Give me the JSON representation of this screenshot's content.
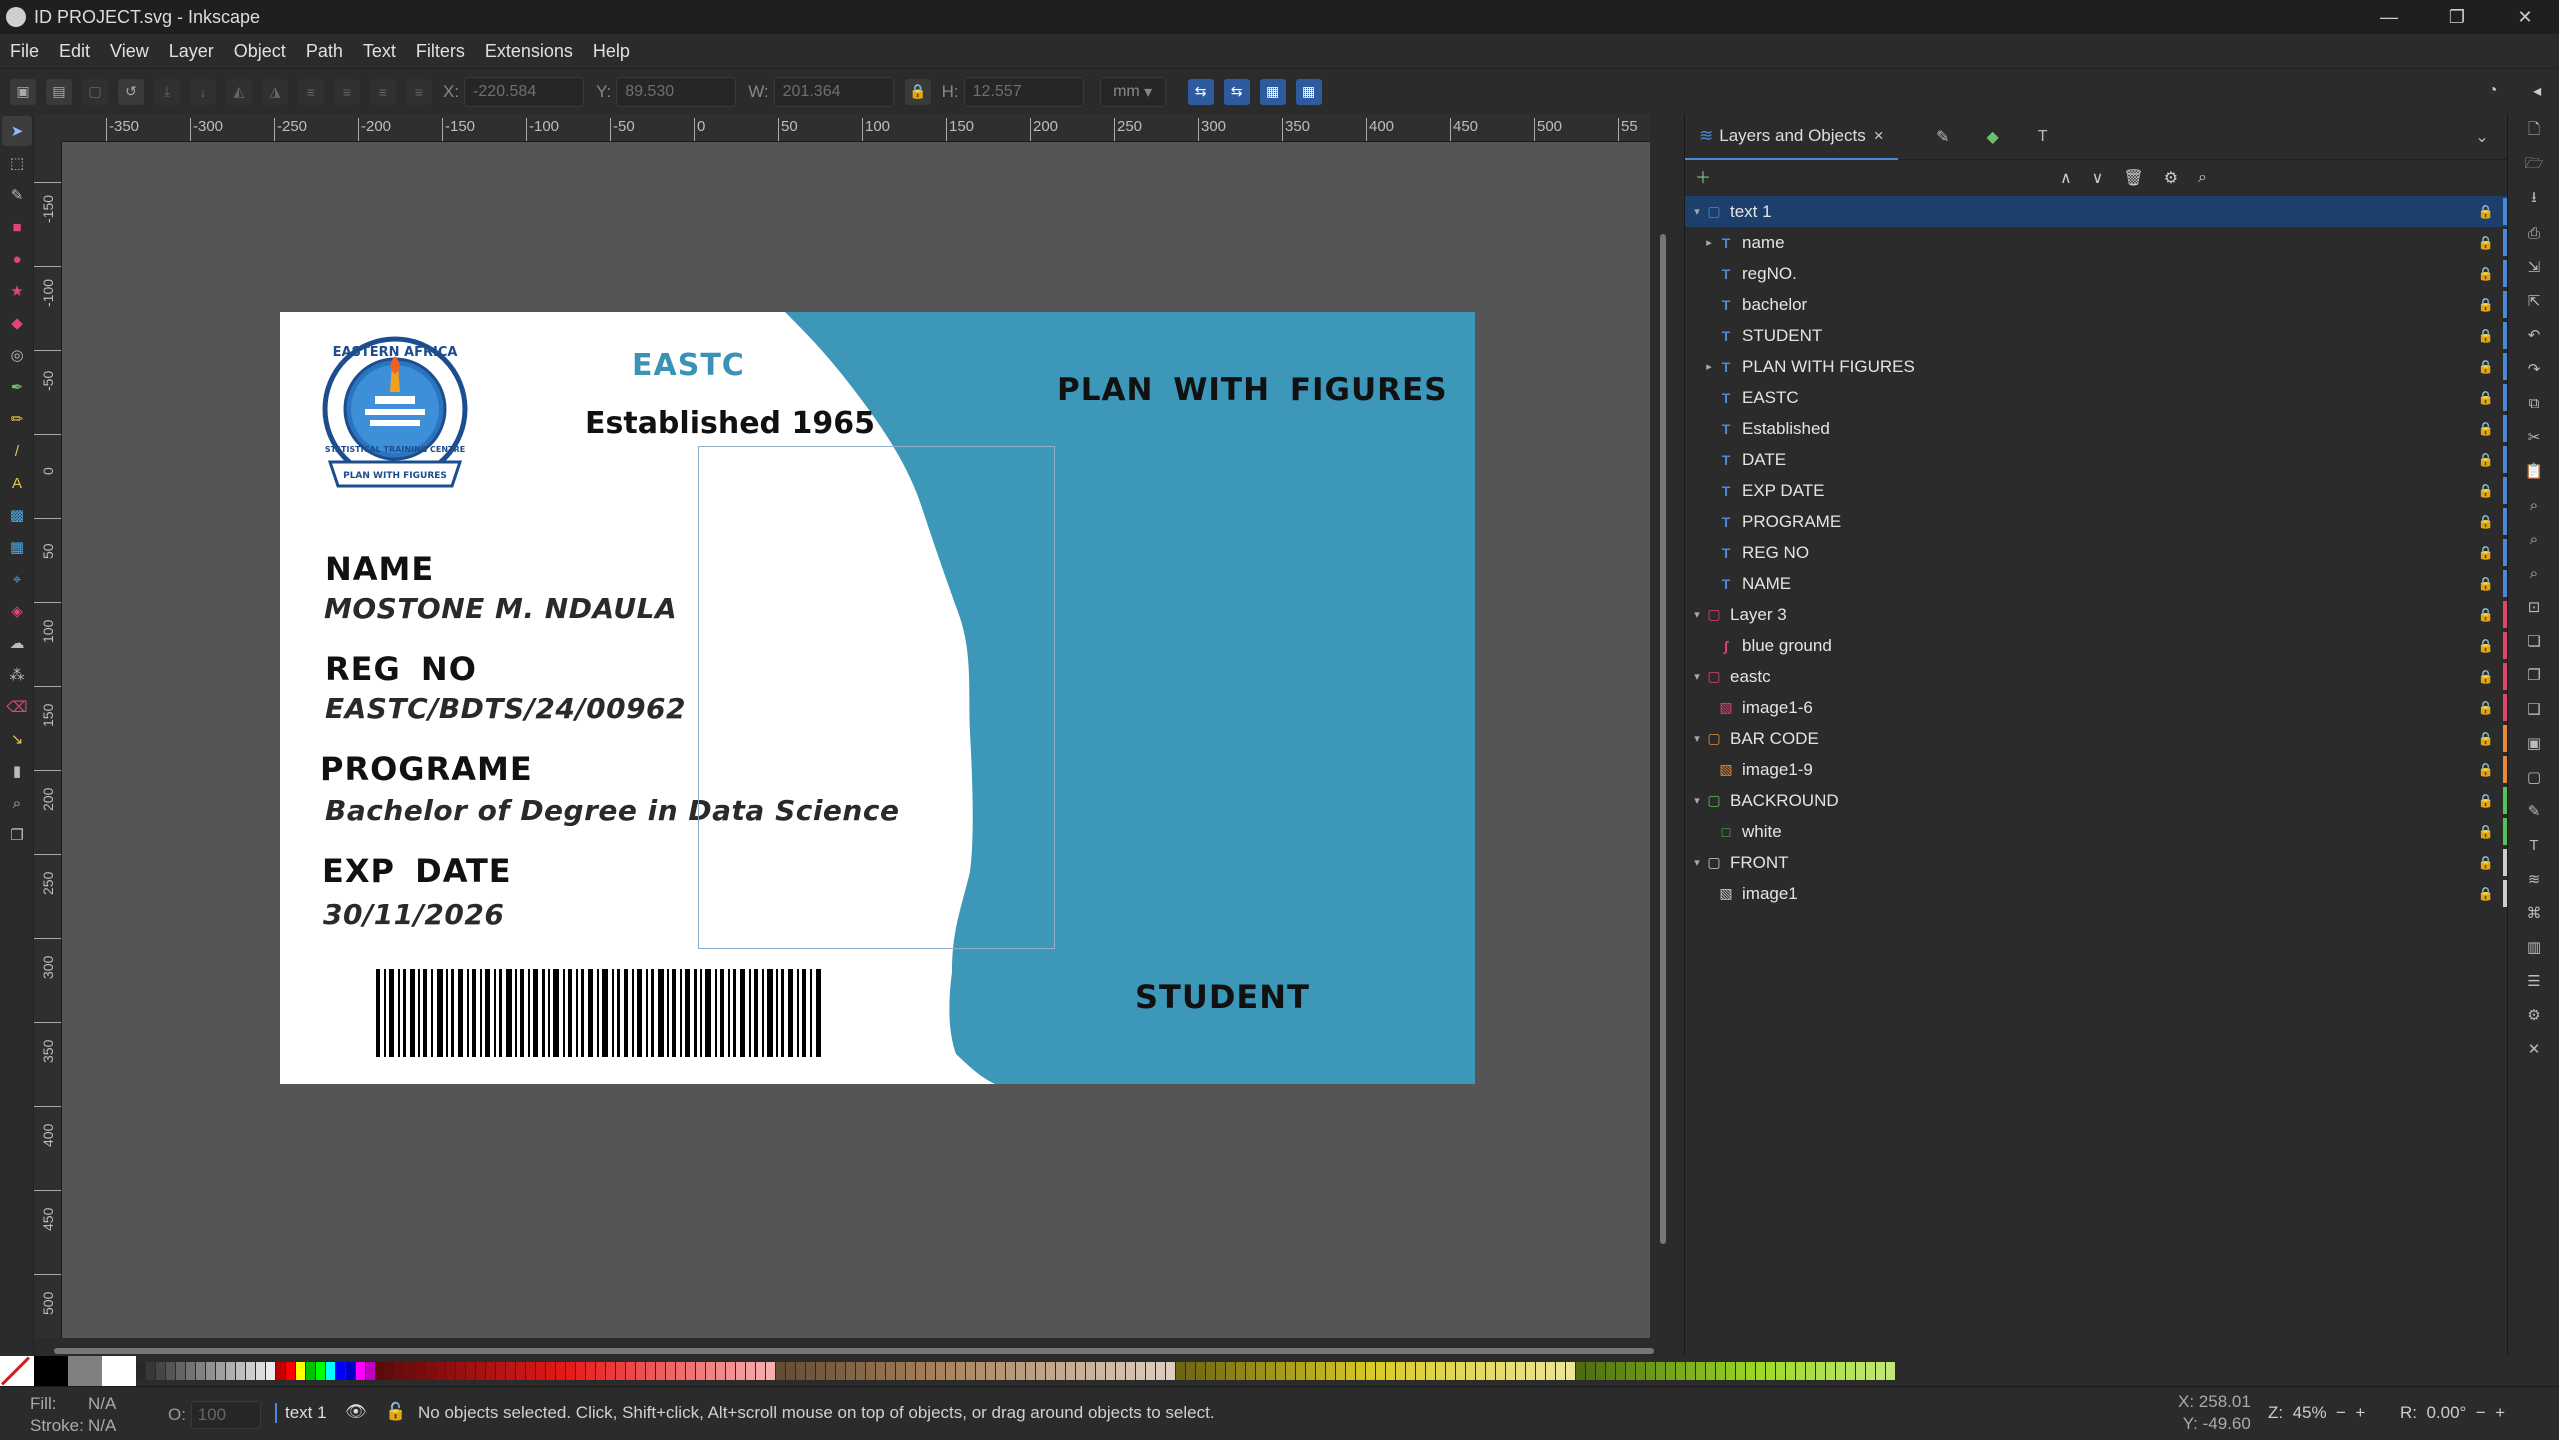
{
  "window": {
    "title": "ID PROJECT.svg - Inkscape",
    "controls": [
      "—",
      "❐",
      "✕"
    ]
  },
  "menu": [
    "File",
    "Edit",
    "View",
    "Layer",
    "Object",
    "Path",
    "Text",
    "Filters",
    "Extensions",
    "Help"
  ],
  "toolcontrols": {
    "x_label": "X:",
    "x_value": "-220.584",
    "y_label": "Y:",
    "y_value": "89.530",
    "w_label": "W:",
    "w_value": "201.364",
    "h_label": "H:",
    "h_value": "12.557",
    "unit": "mm"
  },
  "ruler": {
    "h_ticks": [
      "-350",
      "-300",
      "-250",
      "-200",
      "-150",
      "-100",
      "-50",
      "0",
      "50",
      "100",
      "150",
      "200",
      "250",
      "300",
      "350",
      "400",
      "450",
      "500",
      "55"
    ],
    "v_ticks": [
      "-150",
      "-100",
      "-50",
      "0",
      "50",
      "100",
      "150",
      "200",
      "250",
      "300",
      "350",
      "400",
      "450",
      "500"
    ]
  },
  "card": {
    "eastc": "EASTC",
    "established": "Established  1965",
    "motto": "PLAN  WITH  FIGURES",
    "name_label": "NAME",
    "name_value": "MOSTONE M. NDAULA",
    "reg_label": "REG  NO",
    "reg_value": "EASTC/BDTS/24/00962",
    "program_label": "PROGRAME",
    "program_value": "Bachelor of Degree in Data Science",
    "exp_label": "EXP DATE",
    "exp_value": "30/11/2026",
    "student": "STUDENT",
    "logo_text_top": "EASTERN  AFRICA",
    "logo_text_bottom": "STATISTICAL TRAINING CENTRE",
    "logo_ribbon": "PLAN WITH FIGURES",
    "accent": "#3d97b8"
  },
  "dock": {
    "tab_label": "Layers and Objects",
    "tab_close": "×",
    "items": [
      {
        "label": "text 1",
        "icon": "group-icon",
        "color": "#4a8ad8",
        "selected": true,
        "expander": "▾",
        "indent": 0
      },
      {
        "label": "name",
        "icon": "text-icon",
        "color": "#4a8ad8",
        "expander": "▸",
        "indent": 1
      },
      {
        "label": "regNO.",
        "icon": "text-icon",
        "color": "#4a8ad8",
        "indent": 1
      },
      {
        "label": "bachelor",
        "icon": "text-icon",
        "color": "#4a8ad8",
        "indent": 1
      },
      {
        "label": "STUDENT",
        "icon": "text-icon",
        "color": "#4a8ad8",
        "indent": 1
      },
      {
        "label": "PLAN WITH FIGURES",
        "icon": "text-icon",
        "color": "#4a8ad8",
        "expander": "▸",
        "indent": 1
      },
      {
        "label": "EASTC",
        "icon": "text-icon",
        "color": "#4a8ad8",
        "indent": 1
      },
      {
        "label": "Established",
        "icon": "text-icon",
        "color": "#4a8ad8",
        "indent": 1
      },
      {
        "label": "DATE",
        "icon": "text-icon",
        "color": "#4a8ad8",
        "indent": 1
      },
      {
        "label": "EXP DATE",
        "icon": "text-icon",
        "color": "#4a8ad8",
        "indent": 1
      },
      {
        "label": "PROGRAME",
        "icon": "text-icon",
        "color": "#4a8ad8",
        "indent": 1
      },
      {
        "label": "REG NO",
        "icon": "text-icon",
        "color": "#4a8ad8",
        "indent": 1
      },
      {
        "label": "NAME",
        "icon": "text-icon",
        "color": "#4a8ad8",
        "indent": 1
      },
      {
        "label": "Layer 3",
        "icon": "layer-icon",
        "color": "#e0456a",
        "expander": "▾",
        "indent": 0
      },
      {
        "label": "blue ground",
        "icon": "path-icon",
        "color": "#e0456a",
        "indent": 1
      },
      {
        "label": "eastc",
        "icon": "layer-icon",
        "color": "#e0456a",
        "expander": "▾",
        "indent": 0
      },
      {
        "label": "image1-6",
        "icon": "image-icon",
        "color": "#e0456a",
        "indent": 1
      },
      {
        "label": "BAR CODE",
        "icon": "layer-icon",
        "color": "#e88a3a",
        "expander": "▾",
        "indent": 0
      },
      {
        "label": "image1-9",
        "icon": "image-icon",
        "color": "#e88a3a",
        "indent": 1
      },
      {
        "label": "BACKROUND",
        "icon": "layer-icon",
        "color": "#57c357",
        "expander": "▾",
        "indent": 0
      },
      {
        "label": "white",
        "icon": "rect-icon",
        "color": "#57c357",
        "indent": 1
      },
      {
        "label": "FRONT",
        "icon": "layer-icon",
        "color": "#cccccc",
        "expander": "▾",
        "indent": 0
      },
      {
        "label": "image1",
        "icon": "image-icon",
        "color": "#cccccc",
        "indent": 1
      }
    ]
  },
  "statusbar": {
    "fill_label": "Fill:",
    "fill_value": "N/A",
    "stroke_label": "Stroke:",
    "stroke_value": "N/A",
    "opacity_label": "O:",
    "opacity_value": "100",
    "layer": "text 1",
    "message": "No objects selected. Click, Shift+click, Alt+scroll mouse on top of objects, or drag around objects to select.",
    "x_label": "X:",
    "x_value": "258.01",
    "y_label": "Y:",
    "y_value": "-49.60",
    "zoom_label": "Z:",
    "zoom_value": "45%",
    "rot_label": "R:",
    "rot_value": "0.00°"
  }
}
